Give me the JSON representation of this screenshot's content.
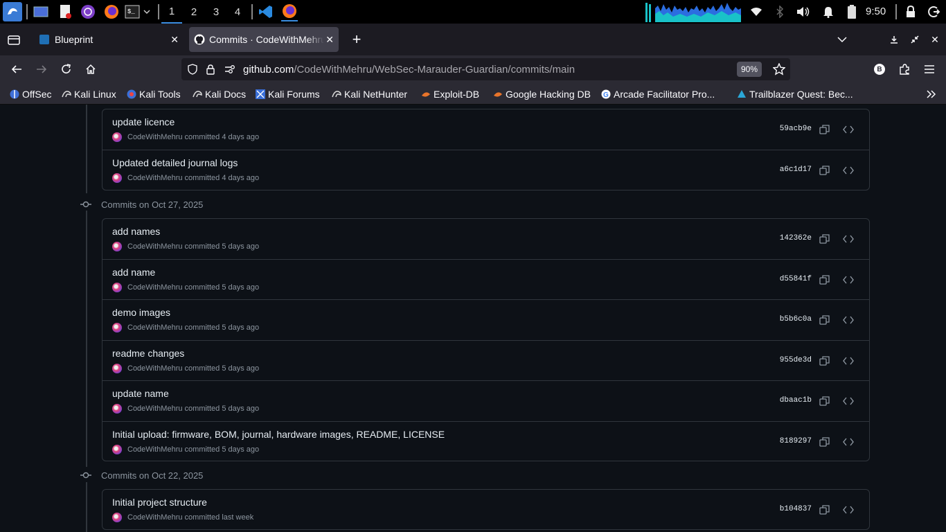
{
  "taskbar": {
    "workspaces": [
      "1",
      "2",
      "3",
      "4"
    ],
    "clock": "9:50"
  },
  "tabs": [
    {
      "title": "Blueprint",
      "active": false
    },
    {
      "title": "Commits · CodeWithMehru",
      "active": true
    }
  ],
  "url": {
    "domain": "github.com",
    "path": "/CodeWithMehru/WebSec-Marauder-Guardian/commits/main",
    "zoom": "90%"
  },
  "bookmarks": [
    {
      "label": "OffSec",
      "icon": "offsec-icon"
    },
    {
      "label": "Kali Linux",
      "icon": "kali-icon"
    },
    {
      "label": "Kali Tools",
      "icon": "kali-tools-icon"
    },
    {
      "label": "Kali Docs",
      "icon": "kali-icon"
    },
    {
      "label": "Kali Forums",
      "icon": "kali-forums-icon"
    },
    {
      "label": "Kali NetHunter",
      "icon": "kali-icon"
    },
    {
      "label": "Exploit-DB",
      "icon": "exploitdb-icon"
    },
    {
      "label": "Google Hacking DB",
      "icon": "exploitdb-icon"
    },
    {
      "label": "Arcade Facilitator Pro...",
      "icon": "google-icon"
    },
    {
      "label": "Trailblazer Quest: Bec...",
      "icon": "trailblazer-icon"
    }
  ],
  "groups": [
    {
      "heading": "",
      "commits": [
        {
          "message": "update licence",
          "author": "CodeWithMehru",
          "when": "committed 4 days ago",
          "sha": "59acb9e"
        },
        {
          "message": "Updated detailed journal logs",
          "author": "CodeWithMehru",
          "when": "committed 4 days ago",
          "sha": "a6c1d17"
        }
      ]
    },
    {
      "heading": "Commits on Oct 27, 2025",
      "commits": [
        {
          "message": "add names",
          "author": "CodeWithMehru",
          "when": "committed 5 days ago",
          "sha": "142362e"
        },
        {
          "message": "add name",
          "author": "CodeWithMehru",
          "when": "committed 5 days ago",
          "sha": "d55841f"
        },
        {
          "message": "demo images",
          "author": "CodeWithMehru",
          "when": "committed 5 days ago",
          "sha": "b5b6c0a"
        },
        {
          "message": "readme changes",
          "author": "CodeWithMehru",
          "when": "committed 5 days ago",
          "sha": "955de3d"
        },
        {
          "message": "update name",
          "author": "CodeWithMehru",
          "when": "committed 5 days ago",
          "sha": "dbaac1b"
        },
        {
          "message": "Initial upload: firmware, BOM, journal, hardware images, README, LICENSE",
          "author": "CodeWithMehru",
          "when": "committed 5 days ago",
          "sha": "8189297"
        }
      ]
    },
    {
      "heading": "Commits on Oct 22, 2025",
      "commits": [
        {
          "message": "Initial project structure",
          "author": "CodeWithMehru",
          "when": "committed last week",
          "sha": "b104837"
        }
      ]
    }
  ]
}
